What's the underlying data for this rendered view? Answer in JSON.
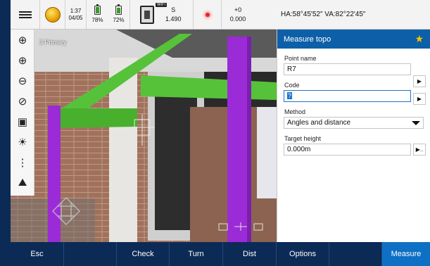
{
  "status": {
    "time": "1:37",
    "date": "04/05",
    "battery1": "78%",
    "battery1_level": 0.78,
    "battery2": "72%",
    "battery2_level": 0.72,
    "instrument_tag": "WiFi",
    "face": "S",
    "distance": "1.490",
    "prism_constant": "+0",
    "ppm": "0.000",
    "angles": "HA:58°45'52\"  VA:82°22'45\""
  },
  "viewport": {
    "label": "3 Primary"
  },
  "toolbar": {
    "icons": [
      "zoom-extents-icon",
      "zoom-in-icon",
      "zoom-out-icon",
      "zoom-previous-icon",
      "camera-icon",
      "brightness-icon",
      "more-icon",
      "map-layers-icon"
    ]
  },
  "panel": {
    "title": "Measure topo",
    "point_name_label": "Point name",
    "point_name_value": "R7",
    "code_label": "Code",
    "code_value": "?",
    "method_label": "Method",
    "method_value": "Angles and distance",
    "target_height_label": "Target height",
    "target_height_value": "0.000m"
  },
  "softkeys": [
    "Esc",
    "",
    "Check",
    "Turn",
    "Dist",
    "Options",
    "",
    "Measure"
  ],
  "colors": {
    "accent": "#0d5fa8",
    "softkey_bg": "#0c2a56",
    "primary_key": "#0d70c4",
    "bim_green": "#56c23a",
    "bim_purple": "#9b2bd6"
  }
}
